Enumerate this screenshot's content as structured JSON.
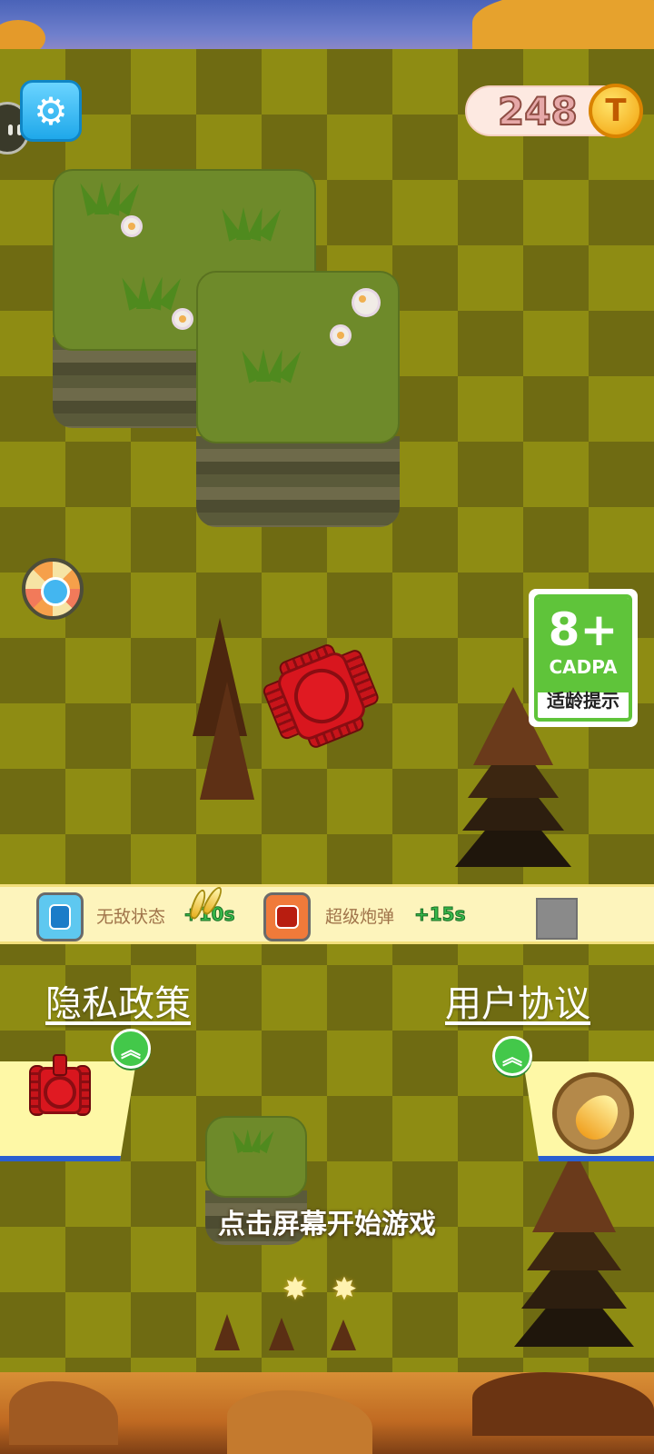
{
  "hud": {
    "coins": "248",
    "coin_symbol": "T",
    "icons": [
      "gear-icon",
      "coin-icon",
      "lucky-wheel-icon"
    ]
  },
  "age_rating": {
    "value": "8+",
    "org": "CADPA",
    "tip": "适龄提示"
  },
  "buffs": [
    {
      "label": "无敌状态",
      "time": "+10s",
      "icon": "shield-powerup-icon"
    },
    {
      "label": "超级炮弹",
      "time": "+15s",
      "icon": "super-shell-powerup-icon"
    }
  ],
  "links": {
    "privacy": "隐私政策",
    "agreement": "用户协议"
  },
  "start_prompt": "点击屏幕开始游戏",
  "colors": {
    "board_light": "#8e8c13",
    "board_dark": "#6f6b12",
    "tank": "#d8161e",
    "buff_bar": "#fdf4bc",
    "age_green": "#5fc43a",
    "upgrade_green": "#43c84a"
  }
}
